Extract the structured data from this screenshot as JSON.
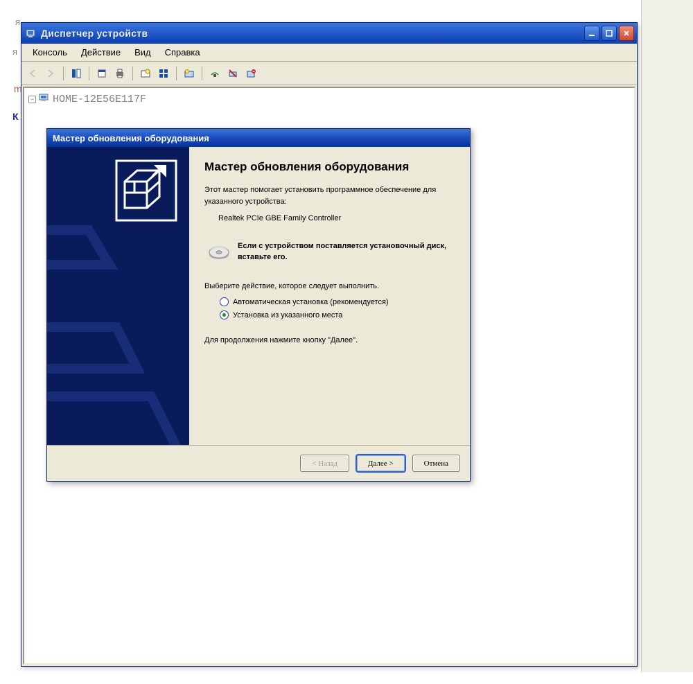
{
  "stray": {
    "a": "я",
    "b": "я",
    "c": "m",
    "d": "К"
  },
  "parent": {
    "title": "Диспетчер устройств",
    "menu": {
      "console": "Консоль",
      "action": "Действие",
      "view": "Вид",
      "help": "Справка"
    },
    "tree": {
      "root": "HOME-12E56E117F"
    }
  },
  "dialog": {
    "title": "Мастер обновления оборудования",
    "heading": "Мастер обновления оборудования",
    "intro1": "Этот мастер помогает установить программное обеспечение для указанного устройства:",
    "device": "Realtek PCIe GBE Family Controller",
    "cd_hint": "Если с устройством поставляется установочный диск, вставьте его.",
    "choose": "Выберите действие, которое следует выполнить.",
    "options": {
      "auto": "Автоматическая установка (рекомендуется)",
      "manual": "Установка из указанного места"
    },
    "selected": "manual",
    "continue": "Для продолжения нажмите кнопку \"Далее\".",
    "buttons": {
      "back": "< Назад",
      "next": "Далее >",
      "cancel": "Отмена"
    }
  }
}
